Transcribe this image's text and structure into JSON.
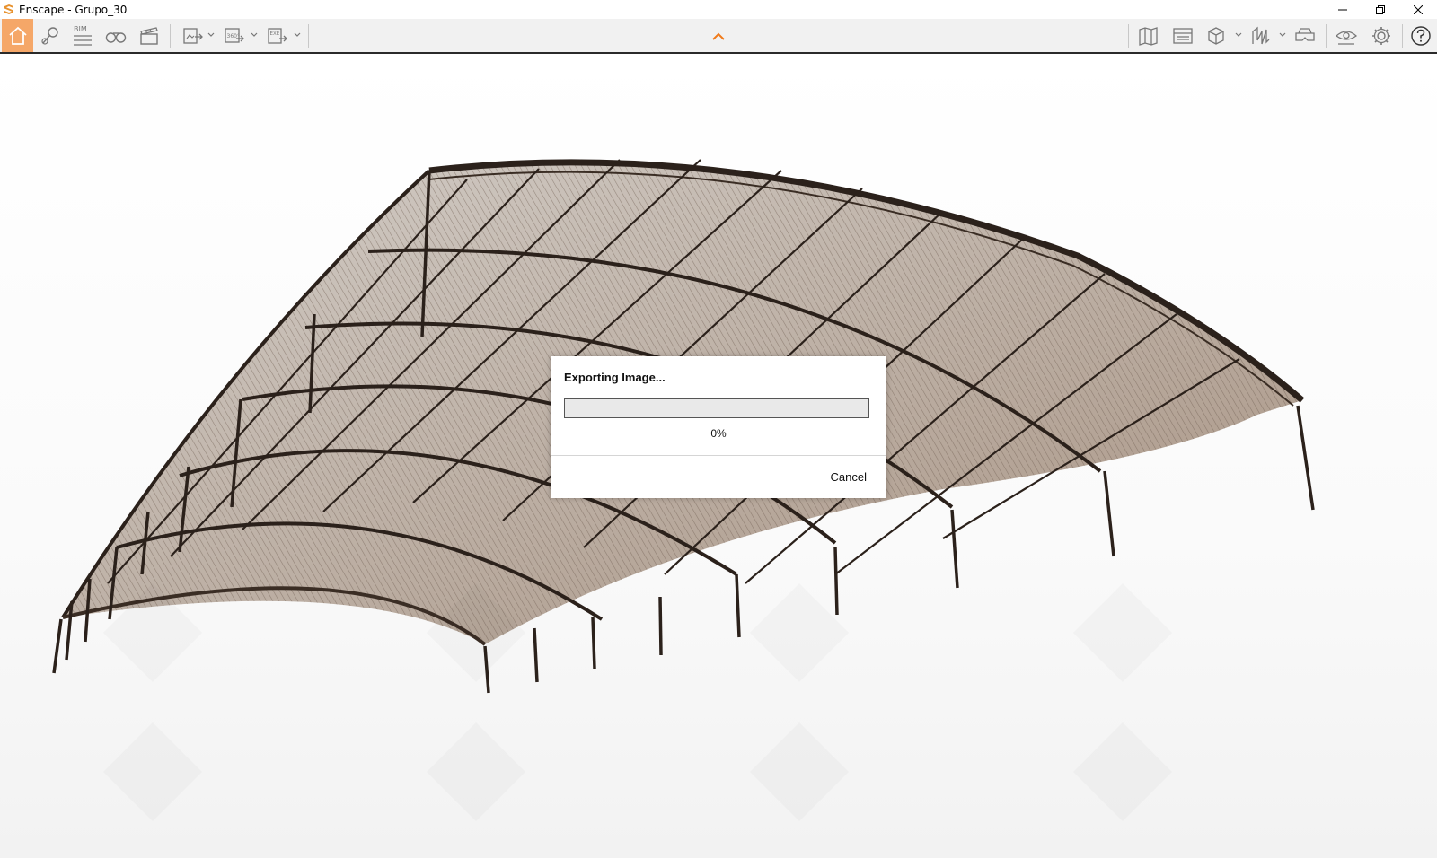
{
  "window": {
    "title": "Enscape - Grupo_30",
    "controls": [
      "minimize-icon",
      "restore-icon",
      "close-icon"
    ]
  },
  "toolbar": {
    "left_tools": [
      {
        "name": "home",
        "icon": "home-icon",
        "active": true
      },
      {
        "name": "location",
        "icon": "map-pin-icon"
      },
      {
        "name": "bim",
        "icon": "bim-icon",
        "label": "BIM"
      },
      {
        "name": "views",
        "icon": "binoculars-icon"
      },
      {
        "name": "video",
        "icon": "clapperboard-icon"
      },
      {
        "name": "export-image",
        "icon": "export-image-icon",
        "dropdown": true
      },
      {
        "name": "export-panorama",
        "icon": "panorama-360-icon",
        "label": "360°",
        "dropdown": true
      },
      {
        "name": "export-exe",
        "icon": "export-exe-icon",
        "label": "EXE",
        "dropdown": true
      }
    ],
    "center_toggle": "chevron-up-icon",
    "right_tools": [
      {
        "name": "map",
        "icon": "map-icon"
      },
      {
        "name": "asset-library",
        "icon": "asset-library-icon"
      },
      {
        "name": "view-mode",
        "icon": "cube-icon",
        "dropdown": true
      },
      {
        "name": "section",
        "icon": "section-icon",
        "dropdown": true
      },
      {
        "name": "vr",
        "icon": "vr-headset-icon"
      },
      {
        "name": "visual-settings",
        "icon": "eye-icon"
      },
      {
        "name": "settings",
        "icon": "gear-icon"
      },
      {
        "name": "help",
        "icon": "help-icon"
      }
    ],
    "accent_color": "#f5a768"
  },
  "dialog": {
    "title": "Exporting Image...",
    "progress": 0,
    "percent_text": "0%",
    "cancel_label": "Cancel"
  }
}
